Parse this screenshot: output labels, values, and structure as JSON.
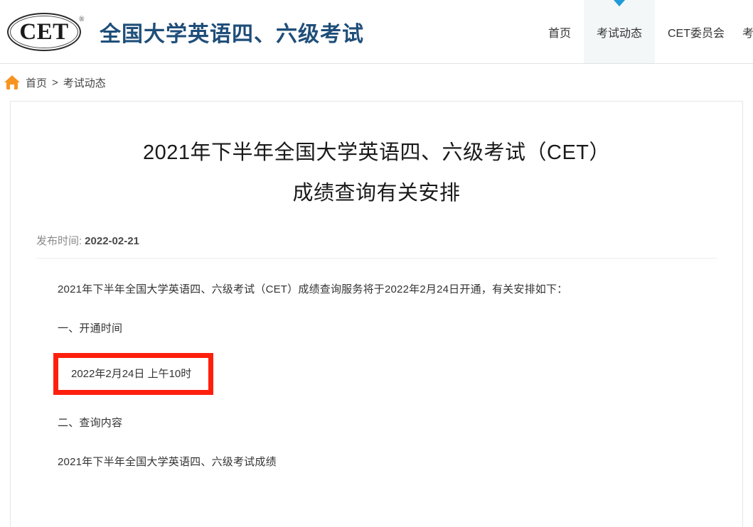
{
  "header": {
    "logo_text": "CET",
    "logo_registered": "®",
    "brand_title": "全国大学英语四、六级考试",
    "brand_color": "#1f4e79",
    "nav": [
      {
        "label": "首页",
        "active": false
      },
      {
        "label": "考试动态",
        "active": true
      },
      {
        "label": "CET委员会",
        "active": false
      },
      {
        "label": "考",
        "active": false
      }
    ],
    "active_caret_color": "#1f9cd8"
  },
  "breadcrumb": {
    "home_icon": "home-icon",
    "home_icon_color": "#f79420",
    "items": [
      "首页",
      "考试动态"
    ],
    "separator": ">"
  },
  "article": {
    "title_line1": "2021年下半年全国大学英语四、六级考试（CET）",
    "title_line2": "成绩查询有关安排",
    "publish_label": "发布时间:",
    "publish_date": "2022-02-21",
    "paragraph_1": "2021年下半年全国大学英语四、六级考试（CET）成绩查询服务将于2022年2月24日开通，有关安排如下：",
    "heading_1": "一、开通时间",
    "highlight_text": "2022年2月24日 上午10时",
    "highlight_border_color": "#ff1f0d",
    "heading_2": "二、查询内容",
    "paragraph_2": "2021年下半年全国大学英语四、六级考试成绩"
  }
}
